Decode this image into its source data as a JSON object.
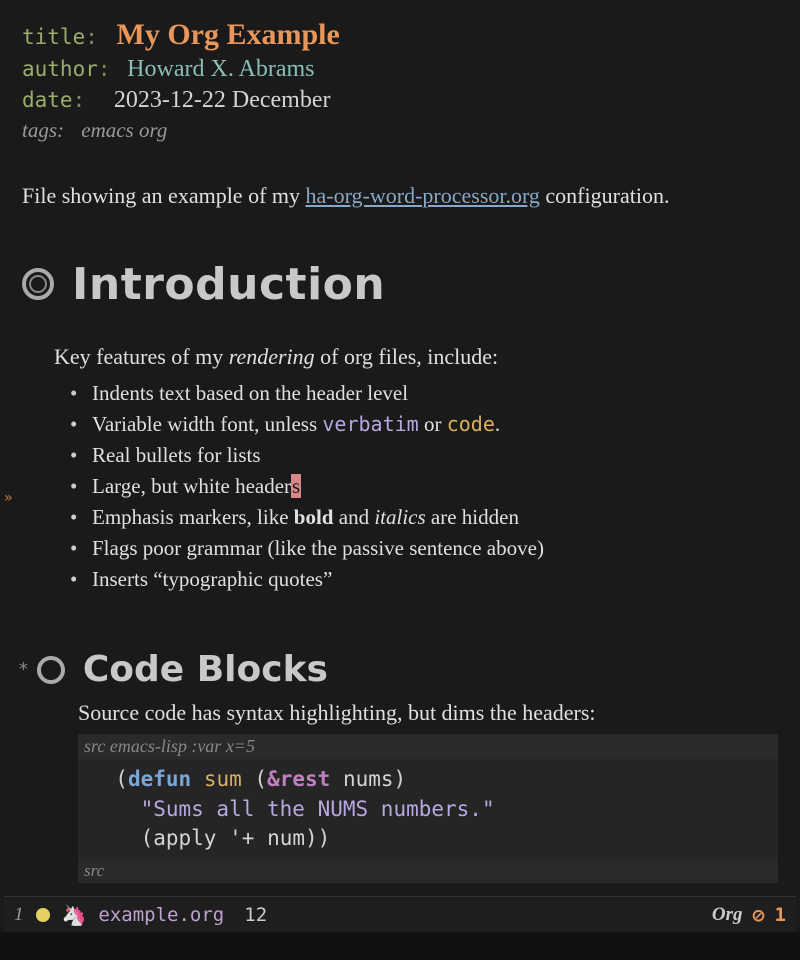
{
  "meta": {
    "title_key": "title",
    "title_value": "My Org Example",
    "author_key": "author",
    "author_value": "Howard X. Abrams",
    "date_key": "date",
    "date_value": "2023-12-22 December",
    "tags_key": "tags:",
    "tags_value": "emacs org"
  },
  "intro": {
    "prefix": "File showing an example of my ",
    "link_text": "ha-org-word-processor.org",
    "suffix": " configuration."
  },
  "headings": {
    "h1": "Introduction",
    "h2_star": "*",
    "h2": "Code Blocks"
  },
  "section_intro": {
    "prefix": "Key features of my ",
    "em": "rendering",
    "suffix": " of org files, include:"
  },
  "bullets": {
    "b1": "Indents text based on the header level",
    "b2_a": "Variable width font, unless ",
    "b2_verbatim": "verbatim",
    "b2_b": " or ",
    "b2_code": "code",
    "b2_c": ".",
    "b3": "Real bullets for lists",
    "b4_a": "Large, but white header",
    "b4_cursor": "s",
    "b5_a": "Emphasis markers, like ",
    "b5_bold": "bold",
    "b5_b": " and ",
    "b5_italic": "italics",
    "b5_c": " are hidden",
    "b6": "Flags poor grammar (like the passive sentence above)",
    "b7": "Inserts “typographic quotes”"
  },
  "code": {
    "desc": "Source code has syntax highlighting, but dims the headers:",
    "src_begin_label": "src",
    "src_begin_args": " emacs-lisp :var x=5",
    "line1_defun": "defun",
    "line1_name": "sum",
    "line1_rest": "&rest",
    "line1_arg": "nums",
    "line2_doc": "\"Sums all the NUMS numbers.\"",
    "line3_apply": "apply",
    "line3_quote": "'+",
    "line3_arg": "num",
    "src_end_label": "src"
  },
  "modeline": {
    "window": "1",
    "unicorn": "🦄",
    "buffer": "example.org",
    "line": "12",
    "mode": "Org",
    "warn_icon": "ⓘ",
    "warn_count": "1"
  },
  "fringe": "»"
}
